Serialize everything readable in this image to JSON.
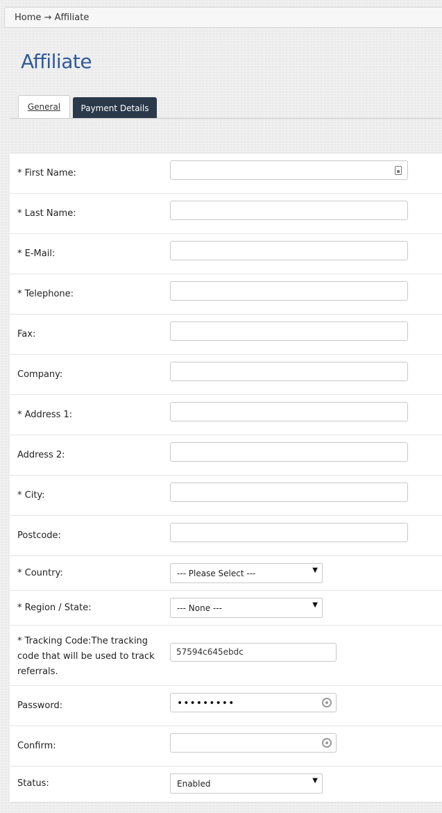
{
  "breadcrumb": {
    "home": "Home",
    "separator": "→",
    "current": "Affiliate"
  },
  "page": {
    "title": "Affiliate"
  },
  "tabs": [
    {
      "label": "General",
      "active": true
    },
    {
      "label": "Payment Details",
      "active": false
    }
  ],
  "form": {
    "first_name": {
      "label": "* First Name:",
      "value": ""
    },
    "last_name": {
      "label": "* Last Name:",
      "value": ""
    },
    "email": {
      "label": "* E-Mail:",
      "value": ""
    },
    "telephone": {
      "label": "* Telephone:",
      "value": ""
    },
    "fax": {
      "label": "Fax:",
      "value": ""
    },
    "company": {
      "label": "Company:",
      "value": ""
    },
    "address1": {
      "label": "* Address 1:",
      "value": ""
    },
    "address2": {
      "label": "Address 2:",
      "value": ""
    },
    "city": {
      "label": "* City:",
      "value": ""
    },
    "postcode": {
      "label": "Postcode:",
      "value": ""
    },
    "country": {
      "label": "* Country:",
      "selected": "--- Please Select ---"
    },
    "region": {
      "label": "* Region / State:",
      "selected": "--- None ---"
    },
    "tracking": {
      "label": "* Tracking Code:The tracking code that will be used to track referrals.",
      "value": "57594c645ebdc"
    },
    "password": {
      "label": "Password:",
      "masked": "•••••••••"
    },
    "confirm": {
      "label": "Confirm:",
      "masked": ""
    },
    "status": {
      "label": "Status:",
      "selected": "Enabled"
    }
  },
  "icons": {
    "contact_card": "contact-card-icon",
    "password_key": "key-icon",
    "dropdown": "chevron-down-icon"
  },
  "colors": {
    "title": "#2f5a9a",
    "active_tab_bg": "#2b3a4a"
  }
}
